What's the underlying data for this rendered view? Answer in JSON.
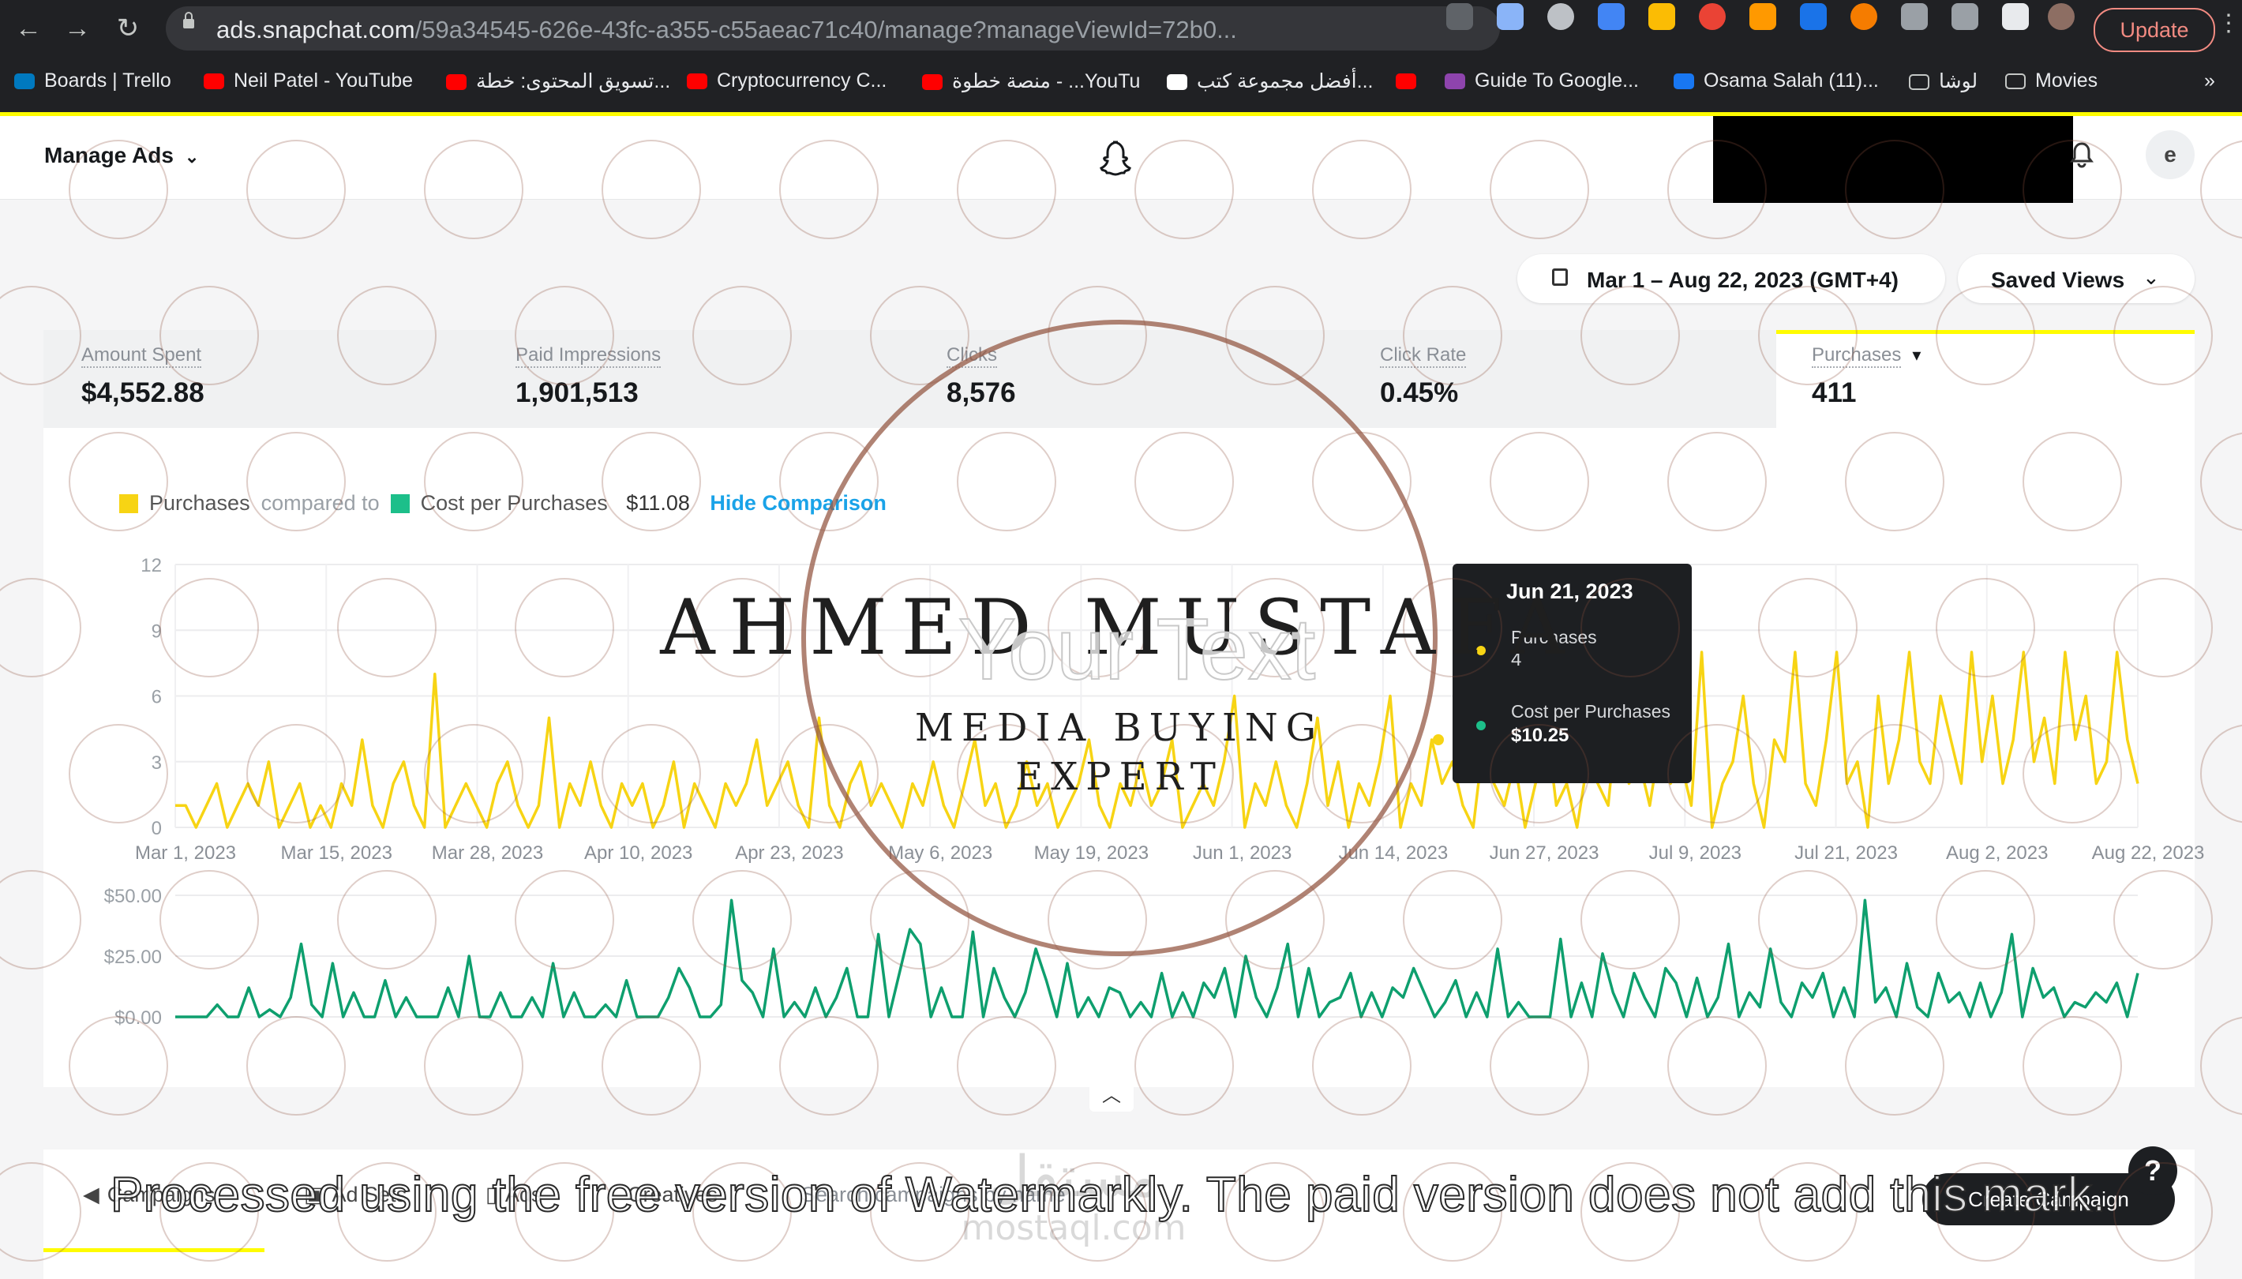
{
  "browser": {
    "url_host": "ads.snapchat.com",
    "url_path": "/59a34545-626e-43fc-a355-c55aeac71c40/manage?manageViewId=72b0...",
    "update_label": "Update",
    "bookmarks": [
      {
        "label": "Boards | Trello",
        "icon_color": "#0079bf"
      },
      {
        "label": "Neil Patel - YouTube",
        "icon_color": "#ff0000"
      },
      {
        "label": "تسويق المحتوى: خطة...",
        "icon_color": "#ff0000"
      },
      {
        "label": "Cryptocurrency C...",
        "icon_color": "#ff0000"
      },
      {
        "label": "منصة خطوة - ...YouTu",
        "icon_color": "#ff0000"
      },
      {
        "label": "أفضل مجموعة كتب...",
        "icon_color": "#ffffff"
      },
      {
        "label": "",
        "icon_color": "#ff0000"
      },
      {
        "label": "Guide To Google...",
        "icon_color": "#8e44ad"
      },
      {
        "label": "Osama Salah (11)...",
        "icon_color": "#1877f2"
      },
      {
        "label": "لوشا",
        "icon_color": "folder"
      },
      {
        "label": "Movies",
        "icon_color": "folder"
      }
    ]
  },
  "header": {
    "title": "Manage Ads",
    "avatar_initial": "e"
  },
  "controls": {
    "date_range": "Mar 1 – Aug 22, 2023 (GMT+4)",
    "saved_views": "Saved Views"
  },
  "metrics": [
    {
      "label": "Amount Spent",
      "value": "$4,552.88"
    },
    {
      "label": "Paid Impressions",
      "value": "1,901,513"
    },
    {
      "label": "Clicks",
      "value": "8,576"
    },
    {
      "label": "Click Rate",
      "value": "0.45%"
    },
    {
      "label": "Purchases",
      "value": "411"
    }
  ],
  "legend": {
    "primary": "Purchases",
    "compared_to": "compared to",
    "secondary": "Cost per Purchases",
    "secondary_total": "$11.08",
    "hide_label": "Hide Comparison"
  },
  "tooltip": {
    "date": "Jun 21, 2023",
    "purchases_label": "Purchases",
    "purchases_value": "4",
    "cost_label": "Cost per Purchases",
    "cost_value": "$10.25"
  },
  "chart_data": [
    {
      "type": "line",
      "x_ticks": [
        "Mar 1, 2023",
        "Mar 15, 2023",
        "Mar 28, 2023",
        "Apr 10, 2023",
        "Apr 23, 2023",
        "May 6, 2023",
        "May 19, 2023",
        "Jun 1, 2023",
        "Jun 14, 2023",
        "Jun 27, 2023",
        "Jul 9, 2023",
        "Jul 21, 2023",
        "Aug 2, 2023",
        "Aug 22, 2023"
      ],
      "y_ticks": [
        "12",
        "9",
        "6",
        "3",
        "0"
      ],
      "ylim": [
        0,
        12
      ],
      "color": "#f7d414",
      "series": [
        {
          "name": "Purchases",
          "values": [
            1,
            1,
            0,
            1,
            2,
            0,
            1,
            2,
            1,
            3,
            0,
            1,
            2,
            0,
            1,
            0,
            2,
            1,
            4,
            1,
            0,
            2,
            3,
            1,
            0,
            7,
            0,
            1,
            2,
            1,
            0,
            2,
            3,
            1,
            0,
            1,
            5,
            0,
            2,
            1,
            3,
            1,
            0,
            2,
            1,
            2,
            0,
            1,
            3,
            0,
            2,
            1,
            0,
            2,
            1,
            2,
            4,
            1,
            2,
            3,
            1,
            0,
            5,
            1,
            0,
            2,
            3,
            1,
            2,
            1,
            0,
            2,
            1,
            3,
            1,
            0,
            2,
            4,
            1,
            2,
            0,
            1,
            3,
            1,
            2,
            0,
            1,
            2,
            4,
            1,
            0,
            2,
            1,
            3,
            1,
            2,
            4,
            0,
            1,
            2,
            1,
            3,
            6,
            0,
            2,
            1,
            3,
            1,
            0,
            2,
            5,
            1,
            3,
            0,
            2,
            1,
            3,
            6,
            0,
            2,
            1,
            4,
            2,
            3,
            1,
            0,
            4,
            2,
            1,
            3,
            0,
            2,
            5,
            1,
            2,
            0,
            3,
            2,
            1,
            6,
            2,
            3,
            1,
            4,
            2,
            3,
            1,
            8,
            0,
            2,
            3,
            6,
            2,
            0,
            4,
            3,
            8,
            2,
            1,
            4,
            8,
            2,
            3,
            0,
            6,
            2,
            4,
            8,
            3,
            2,
            6,
            4,
            2,
            8,
            3,
            6,
            2,
            4,
            8,
            3,
            5,
            2,
            8,
            4,
            6,
            2,
            3,
            8,
            4,
            2
          ]
        }
      ]
    },
    {
      "type": "line",
      "y_ticks": [
        "$50.00",
        "$25.00",
        "$0.00"
      ],
      "ylim": [
        0,
        50
      ],
      "color": "#0e9f6e",
      "series": [
        {
          "name": "Cost per Purchases",
          "values": [
            0,
            0,
            0,
            0,
            5,
            0,
            0,
            12,
            0,
            3,
            0,
            8,
            30,
            5,
            0,
            22,
            0,
            10,
            0,
            0,
            15,
            0,
            8,
            0,
            0,
            0,
            12,
            0,
            25,
            0,
            0,
            10,
            0,
            0,
            8,
            0,
            22,
            0,
            10,
            0,
            0,
            5,
            0,
            15,
            0,
            0,
            0,
            8,
            20,
            12,
            0,
            0,
            5,
            48,
            15,
            10,
            0,
            28,
            0,
            6,
            0,
            12,
            0,
            8,
            20,
            0,
            0,
            34,
            0,
            18,
            36,
            30,
            0,
            12,
            0,
            0,
            35,
            0,
            20,
            8,
            0,
            10,
            28,
            15,
            0,
            22,
            0,
            8,
            0,
            12,
            10,
            0,
            6,
            0,
            18,
            0,
            10,
            0,
            14,
            8,
            20,
            0,
            25,
            8,
            0,
            12,
            30,
            0,
            20,
            0,
            6,
            8,
            18,
            0,
            10,
            0,
            12,
            8,
            20,
            10,
            0,
            6,
            15,
            0,
            10,
            0,
            28,
            0,
            6,
            0,
            0,
            0,
            32,
            0,
            14,
            0,
            26,
            10,
            0,
            18,
            8,
            0,
            20,
            14,
            0,
            16,
            0,
            8,
            30,
            0,
            10,
            4,
            28,
            6,
            0,
            14,
            8,
            18,
            0,
            12,
            0,
            48,
            6,
            12,
            0,
            22,
            4,
            0,
            18,
            6,
            10,
            0,
            14,
            0,
            10,
            34,
            0,
            20,
            8,
            12,
            0,
            6,
            4,
            10,
            6,
            14,
            0,
            18
          ]
        }
      ]
    }
  ],
  "tabs": [
    "Campaigns",
    "Ad Sets",
    "Ads",
    "Creatives"
  ],
  "tab_extra": "Search campaigns by name",
  "create_label": "Create Campaign",
  "watermark": {
    "name": "AHMED MUSTAFA",
    "subtitle_1": "MEDIA BUYING",
    "subtitle_2": "EXPERT",
    "overlay_text": "Your Text",
    "banner": "Processed using the free version of Watermarkly. The paid version does not add this mark.",
    "logo_text": "مستقل",
    "logo_domain": "mostaql.com"
  }
}
